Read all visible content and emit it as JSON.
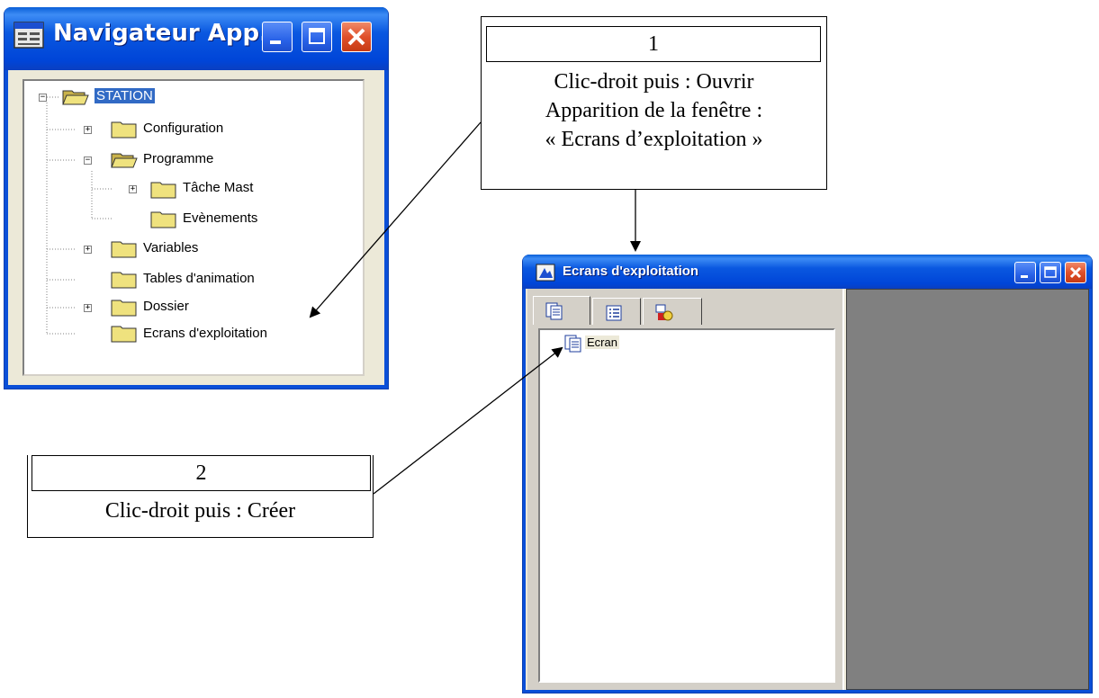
{
  "navigator": {
    "title": "Navigateur App...",
    "tree": {
      "root": "STATION",
      "items": {
        "configuration": "Configuration",
        "programme": "Programme",
        "tache_mast": "Tâche Mast",
        "evenements": "Evènements",
        "variables": "Variables",
        "tables_animation": "Tables d'animation",
        "dossier": "Dossier",
        "ecrans_exploitation": "Ecrans d'exploitation"
      }
    }
  },
  "ecrans_window": {
    "title": "Ecrans d'exploitation",
    "list_item": "Ecran"
  },
  "callout1": {
    "number": "1",
    "line1": "Clic-droit puis : Ouvrir",
    "line2": "Apparition de la fenêtre :",
    "line3": "« Ecrans d’exploitation »"
  },
  "callout2": {
    "number": "2",
    "line1": "Clic-droit puis : Créer"
  },
  "colors": {
    "title_bar_blue": "#0a58e0",
    "close_red": "#e0502a",
    "selection_blue": "#316ac5",
    "pane_gray": "#808080",
    "window_face": "#ece9d8"
  }
}
